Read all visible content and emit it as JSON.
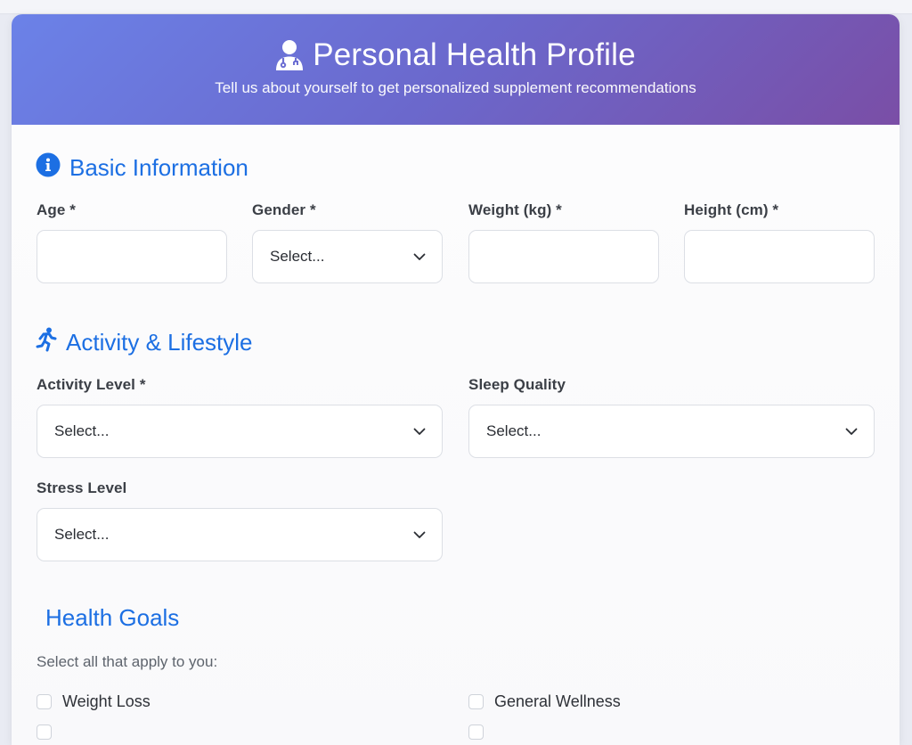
{
  "header": {
    "title": "Personal Health Profile",
    "subtitle": "Tell us about yourself to get personalized supplement recommendations",
    "icon": "user-doctor-icon"
  },
  "basic": {
    "title": "Basic Information",
    "icon": "info-circle-icon",
    "age_label": "Age *",
    "gender_label": "Gender *",
    "gender_value": "Select...",
    "weight_label": "Weight (kg) *",
    "height_label": "Height (cm) *"
  },
  "activity": {
    "title": "Activity & Lifestyle",
    "icon": "running-icon",
    "activity_label": "Activity Level *",
    "activity_value": "Select...",
    "sleep_label": "Sleep Quality",
    "sleep_value": "Select...",
    "stress_label": "Stress Level",
    "stress_value": "Select..."
  },
  "goals": {
    "title": "Health Goals",
    "help": "Select all that apply to you:",
    "options": [
      "Weight Loss",
      "General Wellness"
    ]
  },
  "colors": {
    "accent": "#1c6fe3",
    "header_start": "#6b82e8",
    "header_end": "#7a4ea6"
  }
}
